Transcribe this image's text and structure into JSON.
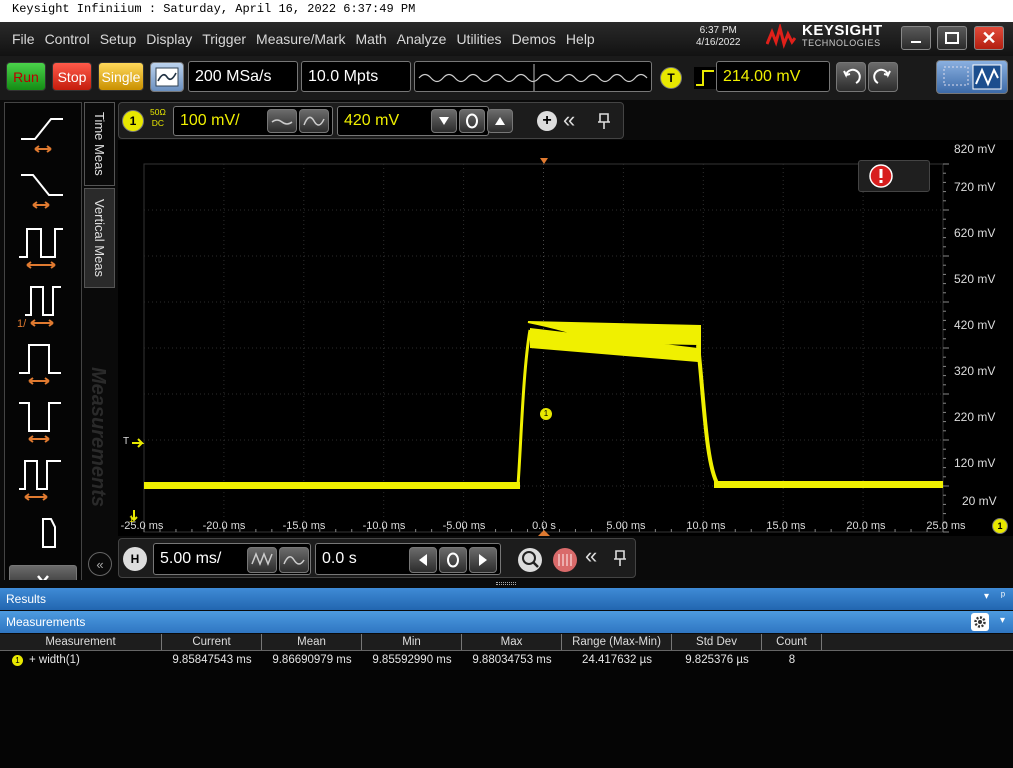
{
  "caption": "Keysight Infiniium : Saturday, April 16, 2022 6:37:49 PM",
  "menu": [
    "File",
    "Control",
    "Setup",
    "Display",
    "Trigger",
    "Measure/Mark",
    "Math",
    "Analyze",
    "Utilities",
    "Demos",
    "Help"
  ],
  "clock": {
    "time": "6:37 PM",
    "date": "4/16/2022"
  },
  "logo": {
    "line1": "KEYSIGHT",
    "line2": "TECHNOLOGIES"
  },
  "toolbar": {
    "run": "Run",
    "stop": "Stop",
    "single": "Single",
    "sample_rate": "200 MSa/s",
    "memory_depth": "10.0 Mpts",
    "trigger_badge": "T",
    "trigger_level": "214.00 mV"
  },
  "channel": {
    "badge": "1",
    "coupling_top": "50Ω",
    "coupling_bottom": "DC",
    "scale": "100 mV/",
    "offset": "420 mV"
  },
  "tabs": {
    "time_meas": "Time Meas",
    "vertical_meas": "Vertical Meas"
  },
  "watermark": "Measurements",
  "screen": {
    "y_labels": [
      "820 mV",
      "720 mV",
      "620 mV",
      "520 mV",
      "420 mV",
      "320 mV",
      "220 mV",
      "120 mV",
      "20 mV"
    ],
    "x_labels": [
      "-25.0 ms",
      "-20.0 ms",
      "-15.0 ms",
      "-10.0 ms",
      "-5.00 ms",
      "0.0 s",
      "5.00 ms",
      "10.0 ms",
      "15.0 ms",
      "20.0 ms",
      "25.0 ms"
    ],
    "trigger_marker": "T",
    "ground_marker": "1",
    "channel_marker": "1",
    "trace_color": "#f0f000"
  },
  "horizontal": {
    "badge": "H",
    "scale": "5.00 ms/",
    "position": "0.0 s"
  },
  "results": {
    "title": "Results",
    "pin": "ᵖ"
  },
  "measurements": {
    "title": "Measurements",
    "columns": [
      "Measurement",
      "Current",
      "Mean",
      "Min",
      "Max",
      "Range (Max-Min)",
      "Std Dev",
      "Count"
    ],
    "rows": [
      {
        "badge": "1",
        "name": "+ width(1)",
        "current": "9.85847543 ms",
        "mean": "9.86690979 ms",
        "min": "9.85592990 ms",
        "max": "9.88034753 ms",
        "range": "24.417632 µs",
        "stddev": "9.825376 µs",
        "count": "8"
      }
    ]
  }
}
